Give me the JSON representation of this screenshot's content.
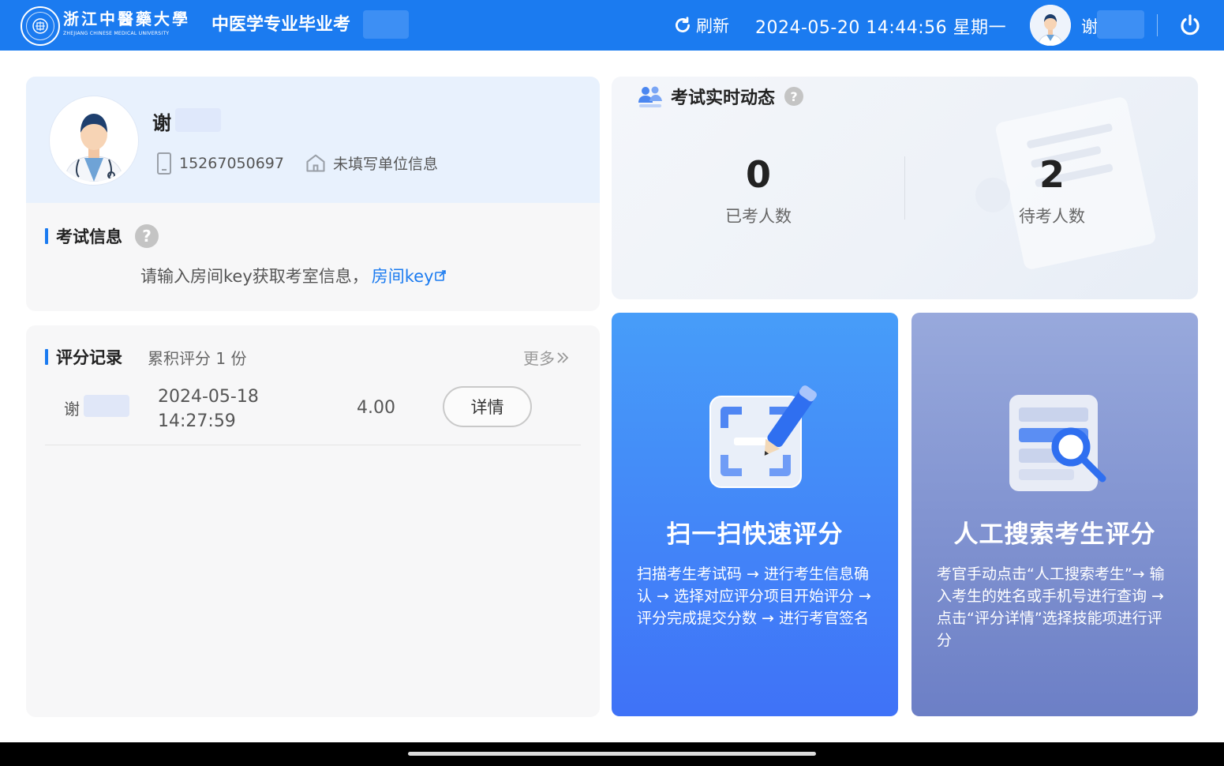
{
  "header": {
    "university_name": "浙江中醫藥大學",
    "university_en": "ZHEJIANG CHINESE MEDICAL UNIVERSITY",
    "app_title": "中医学专业毕业考",
    "refresh_label": "刷新",
    "datetime": "2024-05-20 14:44:56 星期一",
    "user_name": "谢"
  },
  "profile": {
    "name": "谢",
    "phone": "15267050697",
    "unit": "未填写单位信息"
  },
  "exam_info": {
    "title": "考试信息",
    "hint": "请输入房间key获取考室信息，",
    "link_label": "房间key"
  },
  "score_records": {
    "title": "评分记录",
    "count_text": "累积评分 1 份",
    "more_label": "更多",
    "rows": [
      {
        "name": "谢",
        "date": "2024-05-18",
        "time": "14:27:59",
        "score": "4.00",
        "action": "详情"
      }
    ]
  },
  "live": {
    "title": "考试实时动态",
    "taken_count": "0",
    "taken_label": "已考人数",
    "waiting_count": "2",
    "waiting_label": "待考人数"
  },
  "actions": {
    "scan": {
      "title": "扫一扫快速评分",
      "desc": "扫描考生考试码 → 进行考生信息确认 → 选择对应评分项目开始评分 → 评分完成提交分数 → 进行考官签名"
    },
    "search": {
      "title": "人工搜索考生评分",
      "desc": "考官手动点击“人工搜索考生”→ 输入考生的姓名或手机号进行查询 → 点击“评分详情”选择技能项进行评分"
    }
  },
  "colors": {
    "primary": "#1b7bf0",
    "scan_card": "#3f72f7",
    "search_card": "#6c7fc6"
  }
}
